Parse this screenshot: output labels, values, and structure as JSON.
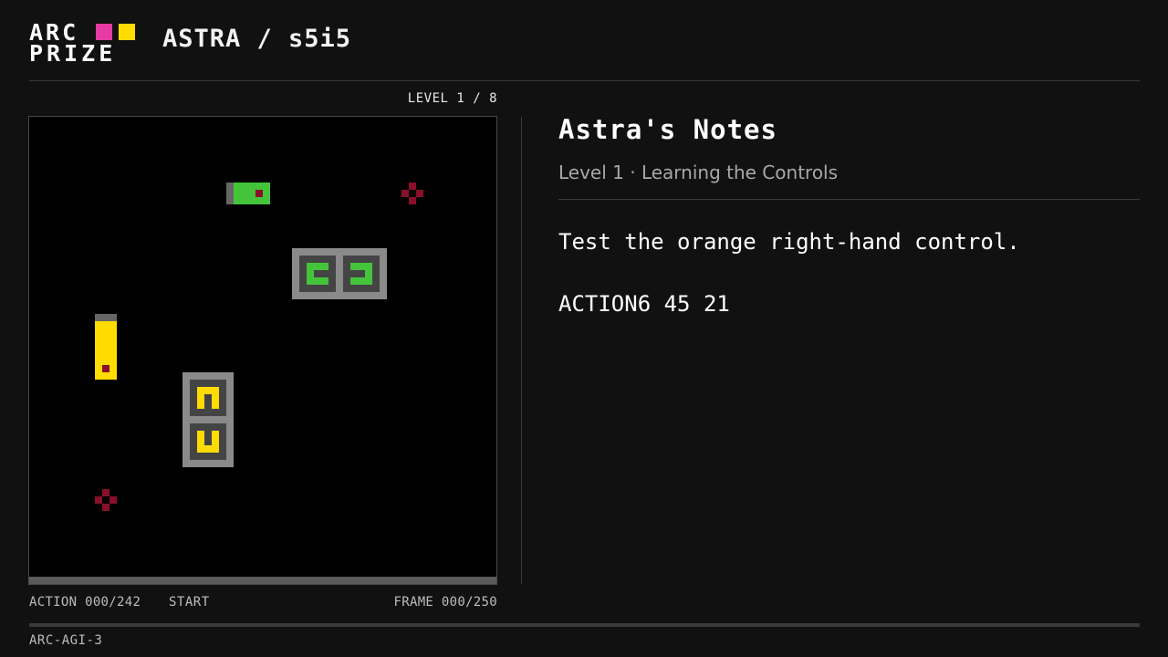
{
  "logo": {
    "line1": "ARC",
    "line2": "PRIZE",
    "accent_pink": "#e53aa4",
    "accent_yellow": "#ffdc00"
  },
  "header": {
    "title": "ASTRA / s5i5"
  },
  "game": {
    "level_label": "LEVEL 1 / 8",
    "action_counter": "ACTION 000/242",
    "status": "START",
    "frame_counter": "FRAME 000/250",
    "progress_fraction": 0,
    "grid": {
      "cols": 64,
      "rows": 63
    },
    "colors": {
      "background": "#000000",
      "gray": "#8a8a8a",
      "dark_gray": "#444444",
      "mid_gray": "#666666",
      "green": "#44c43a",
      "yellow": "#ffdc00",
      "maroon": "#8b0f2a"
    },
    "objects": [
      {
        "type": "green-bar-with-handle",
        "cells": {
          "x": 27,
          "y": 9,
          "w": 6,
          "h": 3
        }
      },
      {
        "type": "maroon-cross",
        "cells": {
          "x": 51,
          "y": 9
        }
      },
      {
        "type": "green-control-pair",
        "cells": {
          "x": 36,
          "y": 18,
          "w": 13,
          "h": 7
        }
      },
      {
        "type": "yellow-bar-with-handle",
        "cells": {
          "x": 9,
          "y": 27,
          "w": 3,
          "h": 9
        }
      },
      {
        "type": "yellow-control-pair",
        "cells": {
          "x": 21,
          "y": 35,
          "w": 7,
          "h": 13
        }
      },
      {
        "type": "maroon-cross",
        "cells": {
          "x": 9,
          "y": 51
        }
      }
    ]
  },
  "notes": {
    "title": "Astra's Notes",
    "subtitle": "Level 1 · Learning the Controls",
    "lines": [
      "Test the orange right-hand control.",
      "ACTION6 45 21"
    ]
  },
  "footer": {
    "tag": "ARC-AGI-3"
  }
}
